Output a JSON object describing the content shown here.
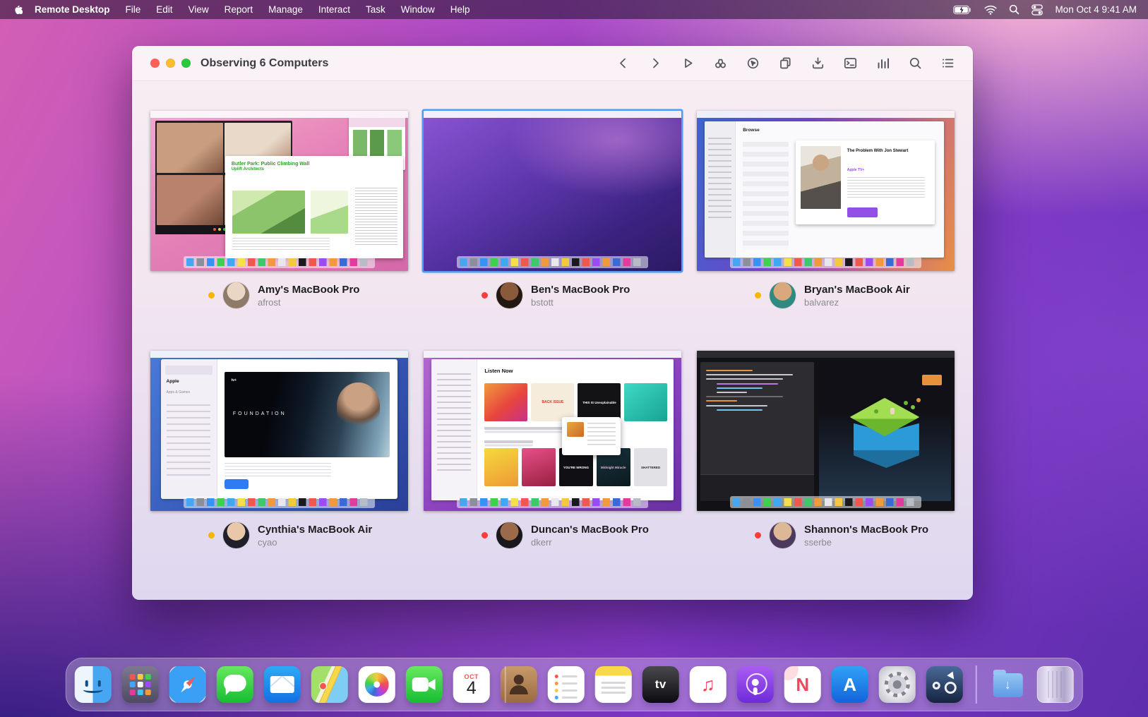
{
  "menu_bar": {
    "app_name": "Remote Desktop",
    "menus": [
      "File",
      "Edit",
      "View",
      "Report",
      "Manage",
      "Interact",
      "Task",
      "Window",
      "Help"
    ],
    "clock": "Mon Oct 4 9:41 AM",
    "status_icons": [
      "battery-charging-icon",
      "wifi-icon",
      "spotlight-search-icon",
      "control-center-icon"
    ]
  },
  "window": {
    "title": "Observing 6 Computers",
    "toolbar_icons": [
      "back-icon",
      "forward-icon",
      "control-icon",
      "observe-icon",
      "curtain-icon",
      "copy-items-icon",
      "install-package-icon",
      "unix-command-icon",
      "reports-icon",
      "search-icon",
      "list-view-icon"
    ]
  },
  "computers": [
    {
      "name": "Amy's MacBook Pro",
      "user": "afrost",
      "status_color": "#f7b500",
      "screen": {
        "doc_title": "Butler Park: Public Climbing Wall",
        "doc_subtitle": "Uplift Architects"
      }
    },
    {
      "name": "Ben's MacBook Pro",
      "user": "bstott",
      "status_color": "#fc3d39",
      "selected": true
    },
    {
      "name": "Bryan's MacBook Air",
      "user": "balvarez",
      "status_color": "#f7b500",
      "screen": {
        "tab": "Browse",
        "show_title": "The Problem With Jon Stewart",
        "network": "Apple TV+"
      }
    },
    {
      "name": "Cynthia's MacBook Air",
      "user": "cyao",
      "status_color": "#f7b500",
      "screen": {
        "sidebar_title": "Apple",
        "sidebar_subtitle": "Apps & Games",
        "hero_title": "FOUNDATION",
        "hero_badge": "tv+"
      }
    },
    {
      "name": "Duncan's MacBook Pro",
      "user": "dkerr",
      "status_color": "#fc3d39",
      "screen": {
        "heading": "Listen Now",
        "tiles": [
          "BACK ISSUE",
          "THIS IS Unexplainable",
          "YOU'RE WRONG",
          "Midnight Miracle",
          "SHATTERED"
        ]
      }
    },
    {
      "name": "Shannon's MacBook Pro",
      "user": "sserbe",
      "status_color": "#fc3d39"
    }
  ],
  "dock": {
    "items": [
      "finder",
      "launchpad",
      "safari",
      "messages",
      "mail",
      "maps",
      "photos",
      "facetime",
      "calendar",
      "contacts",
      "reminders",
      "notes",
      "tv",
      "music",
      "podcasts",
      "news",
      "app-store",
      "system-preferences",
      "remote-desktop",
      "downloads",
      "trash"
    ],
    "calendar": {
      "month": "OCT",
      "day": "4"
    },
    "tv_label": "tv",
    "news_letter": "N",
    "app_store_letter": "A"
  }
}
